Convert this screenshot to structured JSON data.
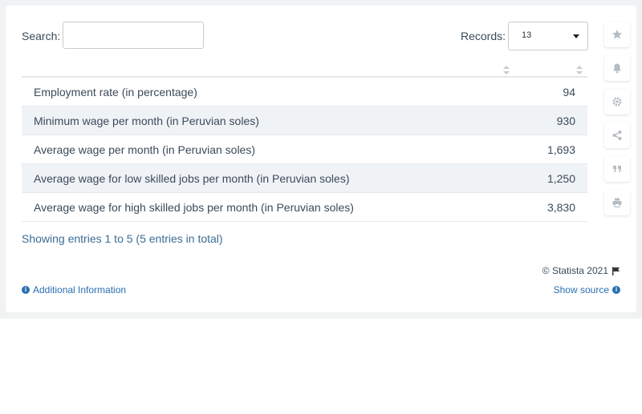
{
  "search": {
    "label": "Search:",
    "value": ""
  },
  "records": {
    "label": "Records:",
    "value": "13"
  },
  "table": {
    "rows": [
      {
        "label": "Employment rate (in percentage)",
        "value": "94"
      },
      {
        "label": "Minimum wage per month (in Peruvian soles)",
        "value": "930"
      },
      {
        "label": "Average wage per month (in Peruvian soles)",
        "value": "1,693"
      },
      {
        "label": "Average wage for low skilled jobs per month (in Peruvian soles)",
        "value": "1,250"
      },
      {
        "label": "Average wage for high skilled jobs per month (in Peruvian soles)",
        "value": "3,830"
      }
    ]
  },
  "footer": {
    "showing": "Showing entries 1 to 5 (5 entries in total)",
    "copyright": "© Statista 2021",
    "additional_info": "Additional Information",
    "show_source": "Show source"
  },
  "sidebar": {
    "icons": [
      "star-icon",
      "bell-icon",
      "gear-icon",
      "share-icon",
      "quote-icon",
      "print-icon"
    ]
  },
  "colors": {
    "link": "#2a6fb0",
    "alt_row": "#f0f3f6",
    "icon": "#b5bcc4"
  },
  "chart_data": {
    "type": "table",
    "rows": [
      {
        "label": "Employment rate (in percentage)",
        "value": 94
      },
      {
        "label": "Minimum wage per month (in Peruvian soles)",
        "value": 930
      },
      {
        "label": "Average wage per month (in Peruvian soles)",
        "value": 1693
      },
      {
        "label": "Average wage for low skilled jobs per month (in Peruvian soles)",
        "value": 1250
      },
      {
        "label": "Average wage for high skilled jobs per month (in Peruvian soles)",
        "value": 3830
      }
    ]
  }
}
